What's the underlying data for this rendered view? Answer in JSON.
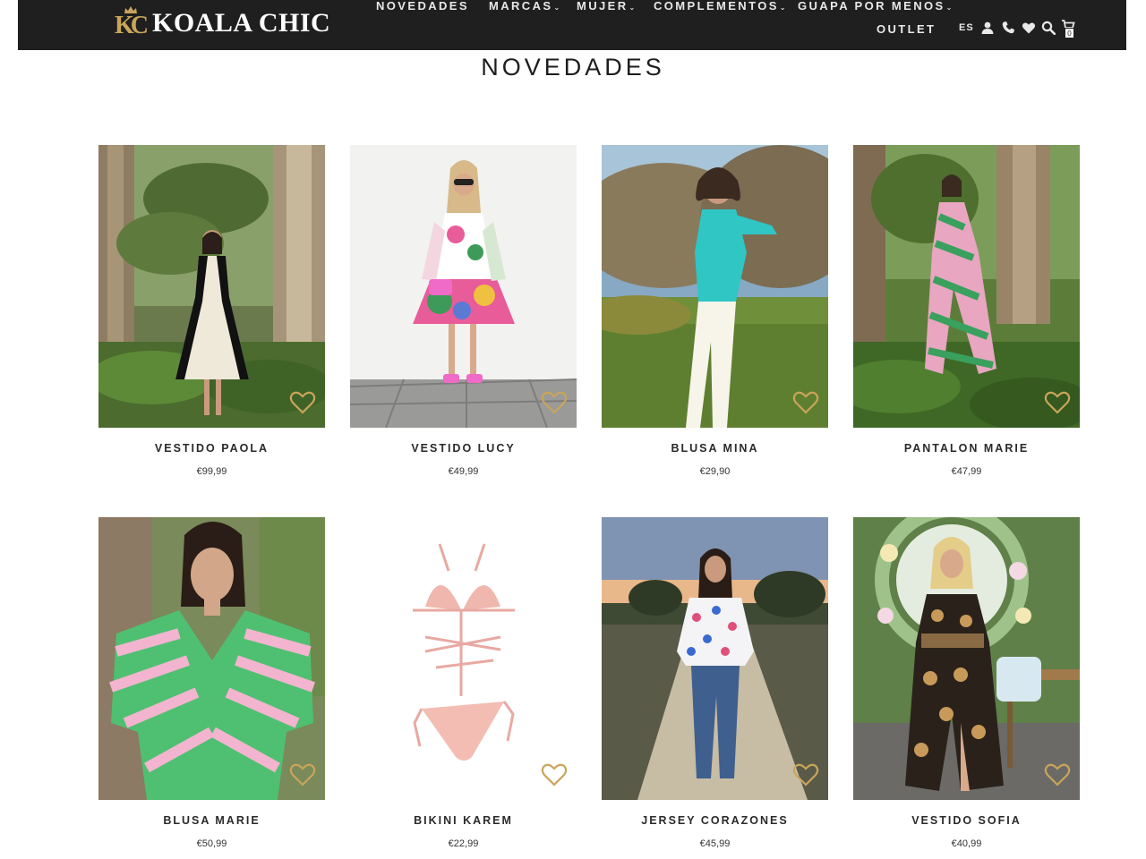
{
  "brand": {
    "name": "KOALA CHIC",
    "monogram": "KC"
  },
  "nav": {
    "items": [
      {
        "label": "NOVEDADES",
        "has_dropdown": false
      },
      {
        "label": "MARCAS",
        "has_dropdown": true
      },
      {
        "label": "MUJER",
        "has_dropdown": true
      },
      {
        "label": "COMPLEMENTOS",
        "has_dropdown": true
      },
      {
        "label": "GUAPA POR MENOS",
        "has_dropdown": true
      },
      {
        "label": "OUTLET",
        "has_dropdown": false
      }
    ],
    "caret": "⌄"
  },
  "utility": {
    "language": "ES",
    "icons": [
      "user-icon",
      "phone-icon",
      "heart-icon",
      "search-icon",
      "cart-icon"
    ],
    "cart_count": "0"
  },
  "page": {
    "title": "NOVEDADES"
  },
  "products": [
    {
      "name": "VESTIDO PAOLA",
      "price": "€99,99"
    },
    {
      "name": "VESTIDO LUCY",
      "price": "€49,99"
    },
    {
      "name": "BLUSA MINA",
      "price": "€29,90"
    },
    {
      "name": "PANTALON MARIE",
      "price": "€47,99"
    },
    {
      "name": "BLUSA MARIE",
      "price": "€50,99"
    },
    {
      "name": "BIKINI KAREM",
      "price": "€22,99"
    },
    {
      "name": "JERSEY CORAZONES",
      "price": "€45,99"
    },
    {
      "name": "VESTIDO SOFIA",
      "price": "€40,99"
    }
  ],
  "colors": {
    "header_bg": "#1f1f1f",
    "brand_gold": "#c9a55a",
    "favorite_outline": "#c9a55a"
  }
}
